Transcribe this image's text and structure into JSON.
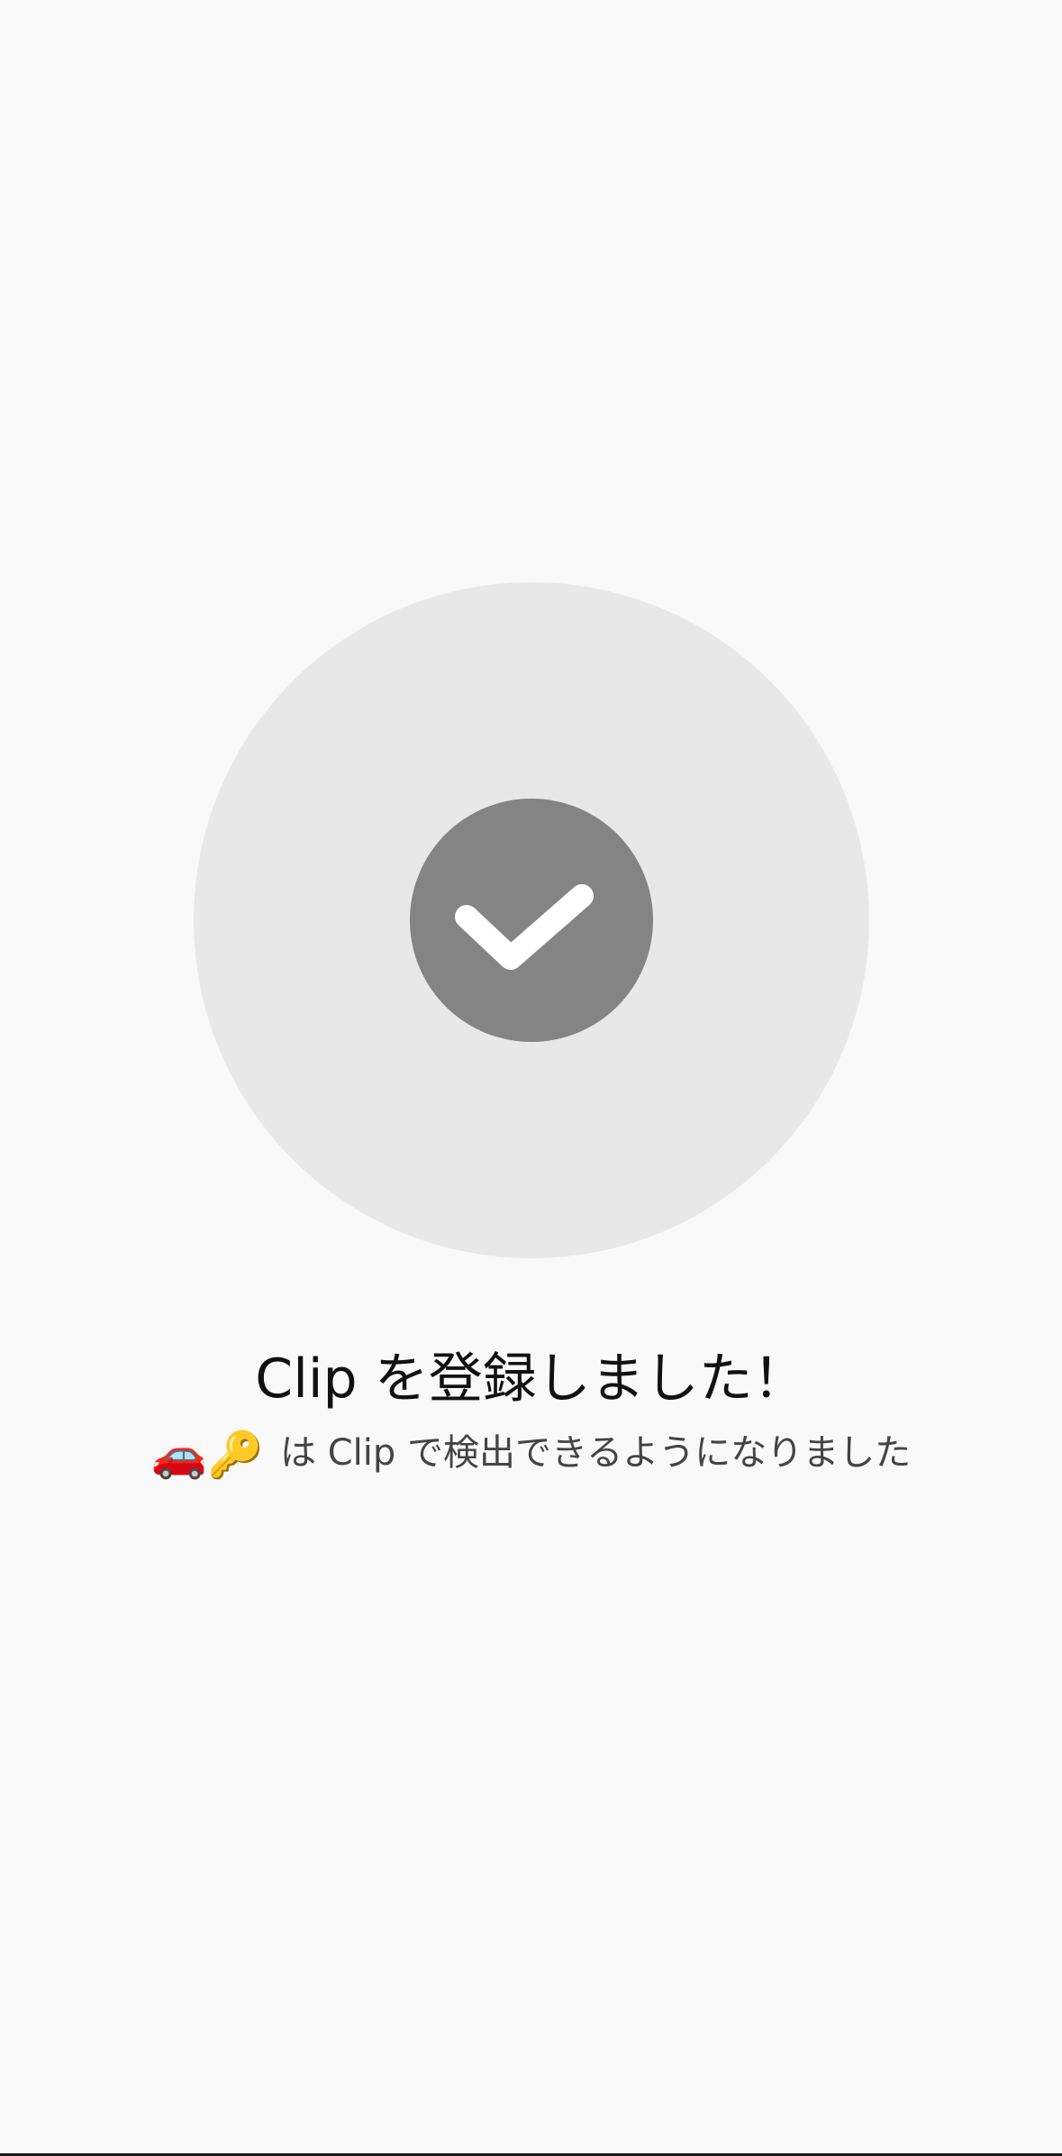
{
  "icon": {
    "name": "checkmark-icon",
    "outer_color": "#e8e8e8",
    "inner_color": "#848484",
    "check_color": "#ffffff"
  },
  "message": {
    "title": "Clip を登録しました！",
    "emoji": "🚗🔑",
    "subtitle": "は Clip で検出できるようになりました"
  }
}
